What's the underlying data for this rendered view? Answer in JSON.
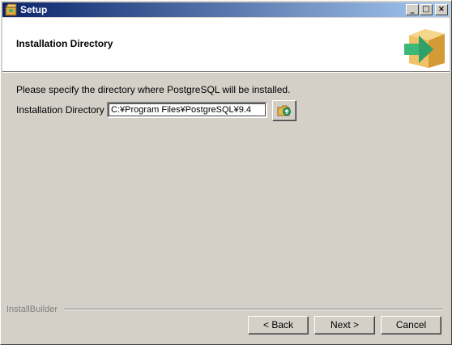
{
  "window": {
    "title": "Setup",
    "controls": {
      "minimize": "_",
      "maximize": "□",
      "close": "×"
    }
  },
  "header": {
    "title": "Installation Directory",
    "logo_icon": "installer-box-arrow-icon"
  },
  "main": {
    "prompt": "Please specify the directory where PostgreSQL will be installed.",
    "directory_label": "Installation Directory",
    "directory_value": "C:¥Program Files¥PostgreSQL¥9.4",
    "browse_icon": "folder-browse-icon"
  },
  "footer": {
    "brand": "InstallBuilder",
    "back_label": "< Back",
    "next_label": "Next >",
    "cancel_label": "Cancel"
  },
  "colors": {
    "titlebar_start": "#0a246a",
    "titlebar_end": "#a6caf0",
    "face": "#d4d0c8",
    "logo_arrow": "#3cb878",
    "logo_box": "#e8b450"
  }
}
